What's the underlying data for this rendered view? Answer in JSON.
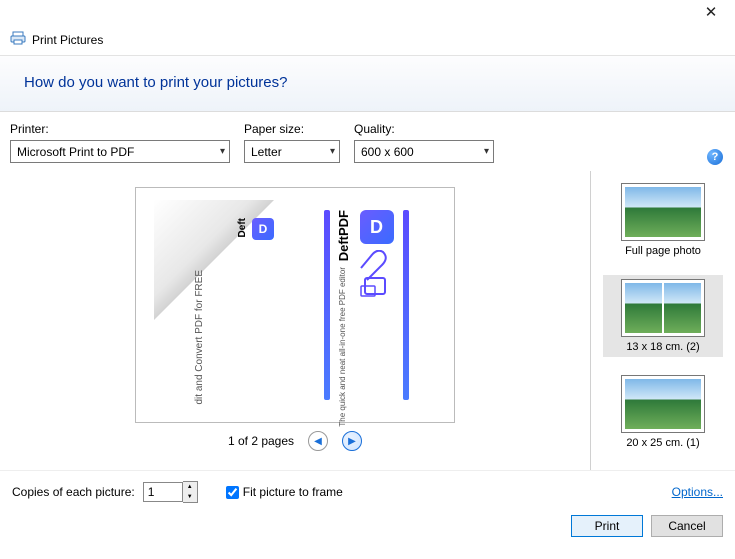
{
  "title": "Print Pictures",
  "banner": "How do you want to print your pictures?",
  "printer_label": "Printer:",
  "printer_value": "Microsoft Print to PDF",
  "paper_label": "Paper size:",
  "paper_value": "Letter",
  "quality_label": "Quality:",
  "quality_value": "600 x 600",
  "preview": {
    "left_text": "dit and Convert PDF for FREE",
    "deft_small": "Deft",
    "deft_large": "DeftPDF",
    "deft_tag": "The quick and neat all-in-one free PDF editor",
    "d_letter": "D"
  },
  "page_counter": "1 of 2 pages",
  "layouts": [
    {
      "caption": "Full page photo",
      "selected": false,
      "type": "single"
    },
    {
      "caption": "13 x 18 cm. (2)",
      "selected": true,
      "type": "double"
    },
    {
      "caption": "20 x 25 cm. (1)",
      "selected": false,
      "type": "single"
    }
  ],
  "copies_label": "Copies of each picture:",
  "copies_value": "1",
  "fit_label": "Fit picture to frame",
  "fit_checked": true,
  "options_link": "Options...",
  "print_btn": "Print",
  "cancel_btn": "Cancel"
}
